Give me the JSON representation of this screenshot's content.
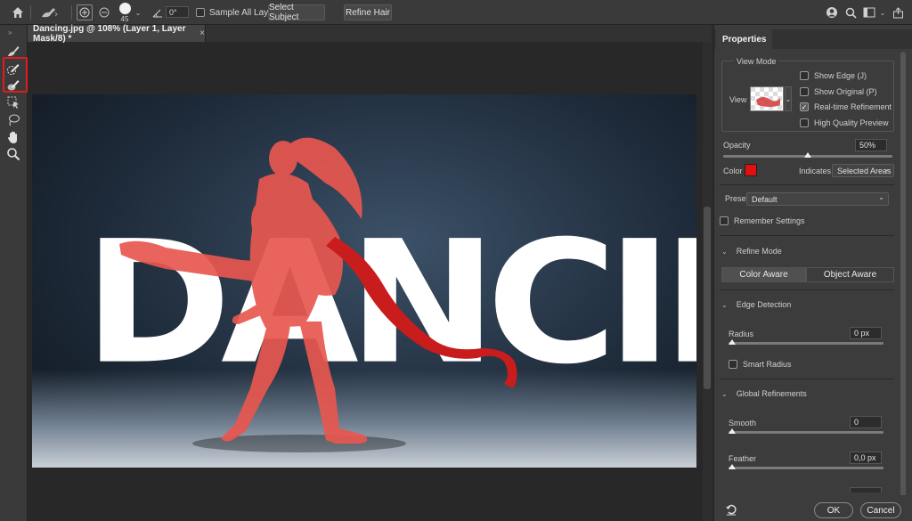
{
  "options_bar": {
    "home_icon": "home-icon",
    "brush_size": "45",
    "angle_value": "0°",
    "sample_all_layers": "Sample All Layers",
    "select_subject": "Select Subject",
    "refine_hair": "Refine Hair"
  },
  "document": {
    "tab_title": "Dancing.jpg @ 108% (Layer 1, Layer Mask/8) *",
    "tab_close": "×",
    "canvas_word": "DANCING"
  },
  "properties": {
    "tab": "Properties",
    "view_mode": {
      "header": "View Mode",
      "view_label": "View",
      "show_edge": "Show Edge (J)",
      "show_original": "Show Original (P)",
      "realtime_refinement": "Real-time Refinement",
      "high_quality_preview": "High Quality Preview",
      "show_edge_checked": false,
      "show_original_checked": false,
      "realtime_checked": true,
      "hq_checked": false
    },
    "opacity_label": "Opacity",
    "opacity_value": "50%",
    "opacity_level": 0.5,
    "color_label": "Color",
    "overlay_color": "#e01010",
    "indicates_label": "Indicates",
    "indicates_value": "Selected Areas",
    "preset_label": "Preset",
    "preset_value": "Default",
    "remember_settings": "Remember Settings",
    "refine_mode": {
      "header": "Refine Mode",
      "color_aware": "Color Aware",
      "object_aware": "Object Aware",
      "active": "Color Aware"
    },
    "edge_detection": {
      "header": "Edge Detection",
      "radius_label": "Radius",
      "radius_value": "0 px",
      "smart_radius": "Smart Radius"
    },
    "global_refinements": {
      "header": "Global Refinements",
      "smooth_label": "Smooth",
      "smooth_value": "0",
      "feather_label": "Feather",
      "feather_value": "0,0 px"
    },
    "ok": "OK",
    "cancel": "Cancel"
  }
}
